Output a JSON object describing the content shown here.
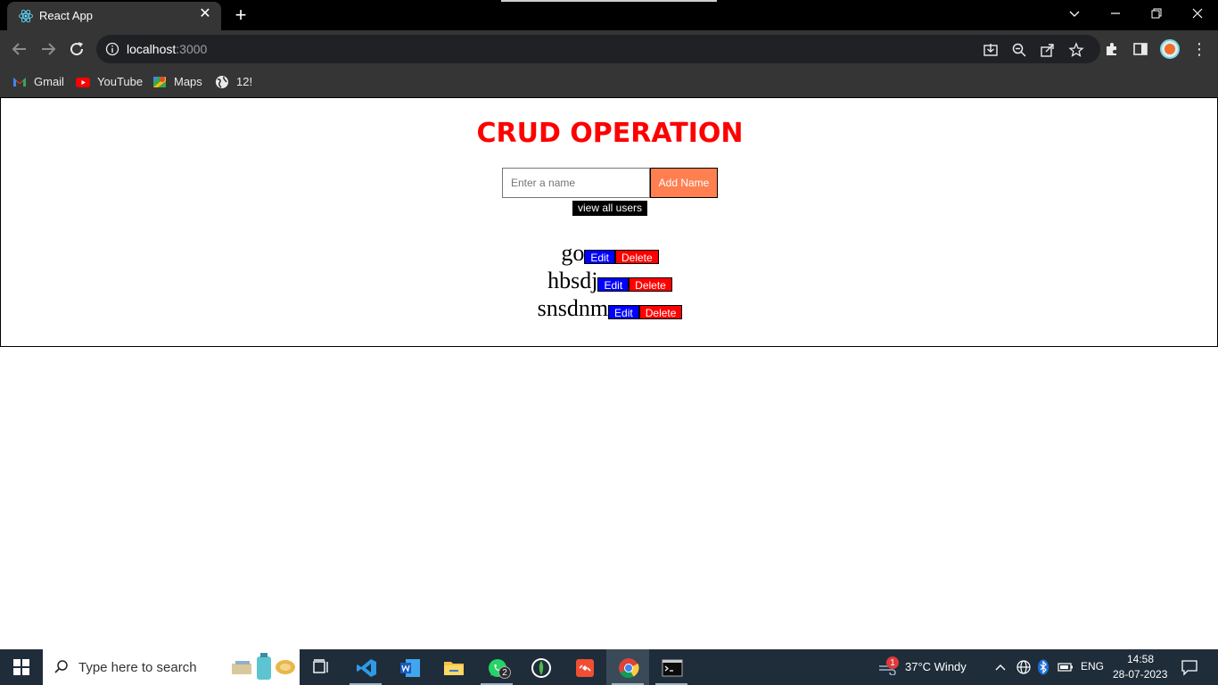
{
  "browser": {
    "tab_title": "React App",
    "url_host": "localhost",
    "url_port": ":3000",
    "bookmarks": [
      {
        "label": "Gmail",
        "icon": "gmail-icon"
      },
      {
        "label": "YouTube",
        "icon": "youtube-icon"
      },
      {
        "label": "Maps",
        "icon": "maps-icon"
      },
      {
        "label": "12!",
        "icon": "globe-icon"
      }
    ]
  },
  "app": {
    "heading": "CRUD OPERATION",
    "input_placeholder": "Enter a name",
    "add_label": "Add Name",
    "view_label": "view all users",
    "edit_label": "Edit",
    "delete_label": "Delete",
    "users": [
      "go",
      "hbsdj",
      "snsdnm"
    ]
  },
  "taskbar": {
    "search_placeholder": "Type here to search",
    "weather": "37°C  Windy",
    "weather_badge": "1",
    "whatsapp_badge": "2",
    "language": "ENG",
    "time": "14:58",
    "date": "28-07-2023"
  },
  "colors": {
    "heading": "#ff0000",
    "add_button": "#ff7f50",
    "edit_button": "#0000ff",
    "delete_button": "#ff0000"
  }
}
